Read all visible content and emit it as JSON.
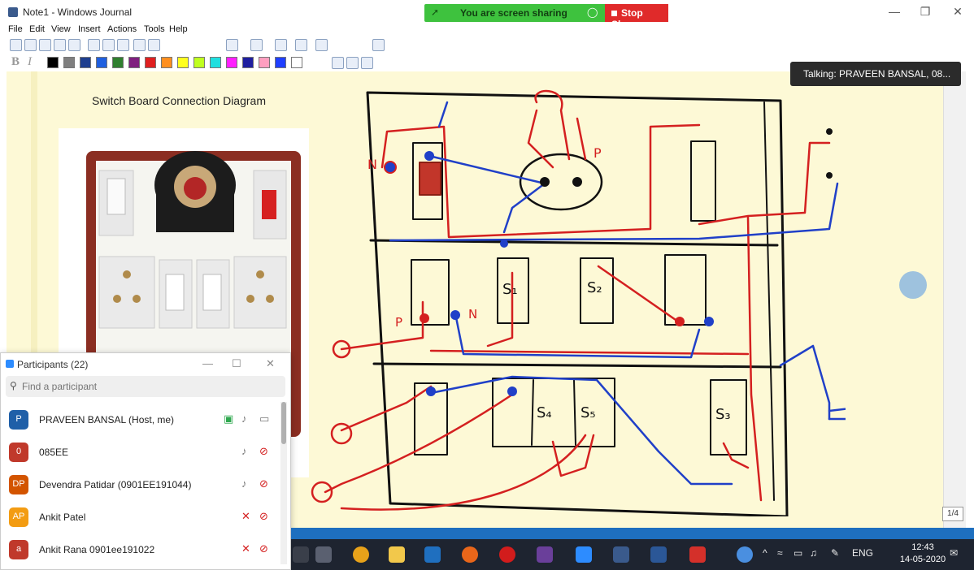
{
  "window": {
    "title": "Note1 - Windows Journal"
  },
  "menu": [
    "File",
    "Edit",
    "View",
    "Insert",
    "Actions",
    "Tools",
    "Help"
  ],
  "sharing": {
    "status": "You are screen sharing",
    "stop_label": "Stop Share"
  },
  "toolbar": {
    "bold": "B",
    "italic": "I",
    "colors": [
      "#000000",
      "#7f7f7f",
      "#1f3f8f",
      "#1f5fdf",
      "#2f7f2f",
      "#7f1f7f",
      "#df1f1f",
      "#ff8f1f",
      "#ffff1f",
      "#bfff1f",
      "#1fdfdf",
      "#ff1fff",
      "#1f1f9f",
      "#ff9fc0",
      "#1f3fff",
      "#ffffff"
    ]
  },
  "page": {
    "title": "Switch Board Connection Diagram",
    "indicator": "1/4"
  },
  "talking": "Talking: PRAVEEN BANSAL, 08...",
  "participants": {
    "title": "Participants (22)",
    "search_placeholder": "Find a participant",
    "list": [
      {
        "initials": "P",
        "name": "PRAVEEN BANSAL (Host, me)",
        "color": "#1f5fa8"
      },
      {
        "initials": "0",
        "name": "085EE",
        "color": "#c0392b"
      },
      {
        "initials": "DP",
        "name": "Devendra Patidar (0901EE191044)",
        "color": "#d35400"
      },
      {
        "initials": "AP",
        "name": "Ankit Patel",
        "color": "#f39c12"
      },
      {
        "initials": "a",
        "name": "Ankit Rana 0901ee191022",
        "color": "#c0392b"
      }
    ]
  },
  "diagram_labels": {
    "p": "P",
    "n": "N",
    "s1": "S₁",
    "s2": "S₂",
    "s3": "S₃",
    "s4": "S₄",
    "s5": "S₅"
  },
  "taskbar": {
    "lang": "ENG",
    "time": "12:43",
    "date": "14-05-2020"
  }
}
